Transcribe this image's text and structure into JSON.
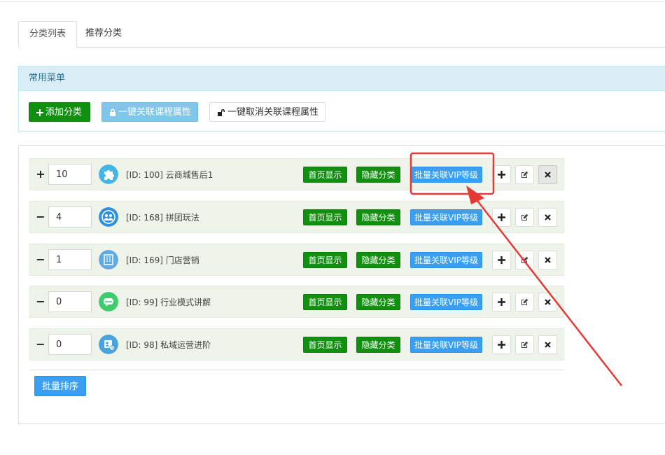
{
  "tabs": [
    {
      "label": "分类列表",
      "active": true
    },
    {
      "label": "推荐分类",
      "active": false
    }
  ],
  "menu": {
    "title": "常用菜单",
    "add_label": "添加分类",
    "link_label": "一键关联课程属性",
    "unlink_label": "一键取消关联课程属性"
  },
  "rows": [
    {
      "toggle": "+",
      "sort": "10",
      "label": "[ID: 100] 云商城售后1",
      "icon": "puzzle-icon",
      "icon_color": "#45b5e8"
    },
    {
      "toggle": "−",
      "sort": "4",
      "label": "[ID: 168] 拼团玩法",
      "icon": "group-icon",
      "icon_color": "#2f8fe0"
    },
    {
      "toggle": "−",
      "sort": "1",
      "label": "[ID: 169] 门店营销",
      "icon": "building-icon",
      "icon_color": "#5ea9e6"
    },
    {
      "toggle": "−",
      "sort": "0",
      "label": "[ID: 99] 行业模式讲解",
      "icon": "chat-icon",
      "icon_color": "#3ecb6e"
    },
    {
      "toggle": "−",
      "sort": "0",
      "label": "[ID: 98] 私域运营进阶",
      "icon": "profile-icon",
      "icon_color": "#4aa3dc"
    }
  ],
  "row_buttons": {
    "home_label": "首页显示",
    "hide_label": "隐藏分类",
    "vip_label": "批量关联VIP等级"
  },
  "batch_sort_label": "批量排序",
  "colors": {
    "green": "#118f0f",
    "blue": "#3a9ff3",
    "light_blue": "#7fc6ea",
    "annotation_red": "#e53935"
  }
}
